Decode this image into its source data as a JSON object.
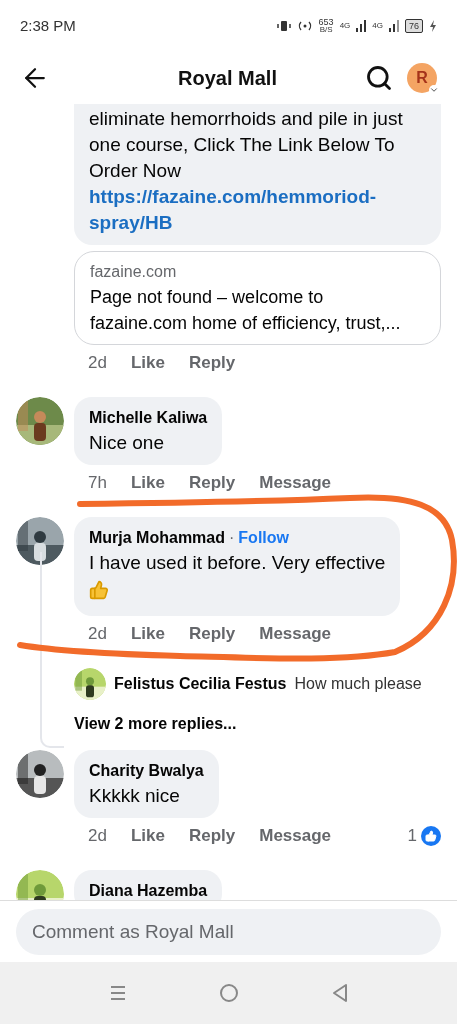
{
  "status_bar": {
    "time": "2:38 PM",
    "data_rate": "653",
    "data_unit": "B/S",
    "network_1": "4G",
    "network_2": "4G",
    "battery": "76"
  },
  "header": {
    "title": "Royal Mall",
    "avatar_letter": "R"
  },
  "comments": [
    {
      "avatar": false,
      "text": "eliminate hemorrhoids and pile in just one course, Click The Link Below To Order Now",
      "link": "https://fazaine.com/hemmoriod-spray/HB",
      "preview": {
        "domain": "fazaine.com",
        "title": "Page not found – welcome to fazaine.com home of efficiency, trust,..."
      },
      "actions": {
        "time": "2d",
        "like": "Like",
        "reply": "Reply"
      }
    },
    {
      "avatar": true,
      "name": "Michelle Kaliwa",
      "text": "Nice one",
      "actions": {
        "time": "7h",
        "like": "Like",
        "reply": "Reply",
        "message": "Message"
      }
    },
    {
      "avatar": true,
      "name": "Murja Mohammad",
      "follow_separator": "·",
      "follow": "Follow",
      "text": "I have used it before. Very effective",
      "thumbs_up_emoji": true,
      "actions": {
        "time": "2d",
        "like": "Like",
        "reply": "Reply",
        "message": "Message"
      },
      "replies": [
        {
          "name": "Felistus Cecilia Festus",
          "text": "How much please"
        }
      ],
      "more_replies": "View 2 more replies..."
    },
    {
      "avatar": true,
      "name": "Charity Bwalya",
      "text": "Kkkkk nice",
      "actions": {
        "time": "2d",
        "like": "Like",
        "reply": "Reply",
        "message": "Message",
        "reaction_count": "1"
      }
    },
    {
      "avatar": true,
      "name": "Diana Hazemba"
    }
  ],
  "composer": {
    "placeholder": "Comment as Royal Mall"
  },
  "annotation": {
    "kind": "scribble",
    "color": "#f26b2a"
  }
}
